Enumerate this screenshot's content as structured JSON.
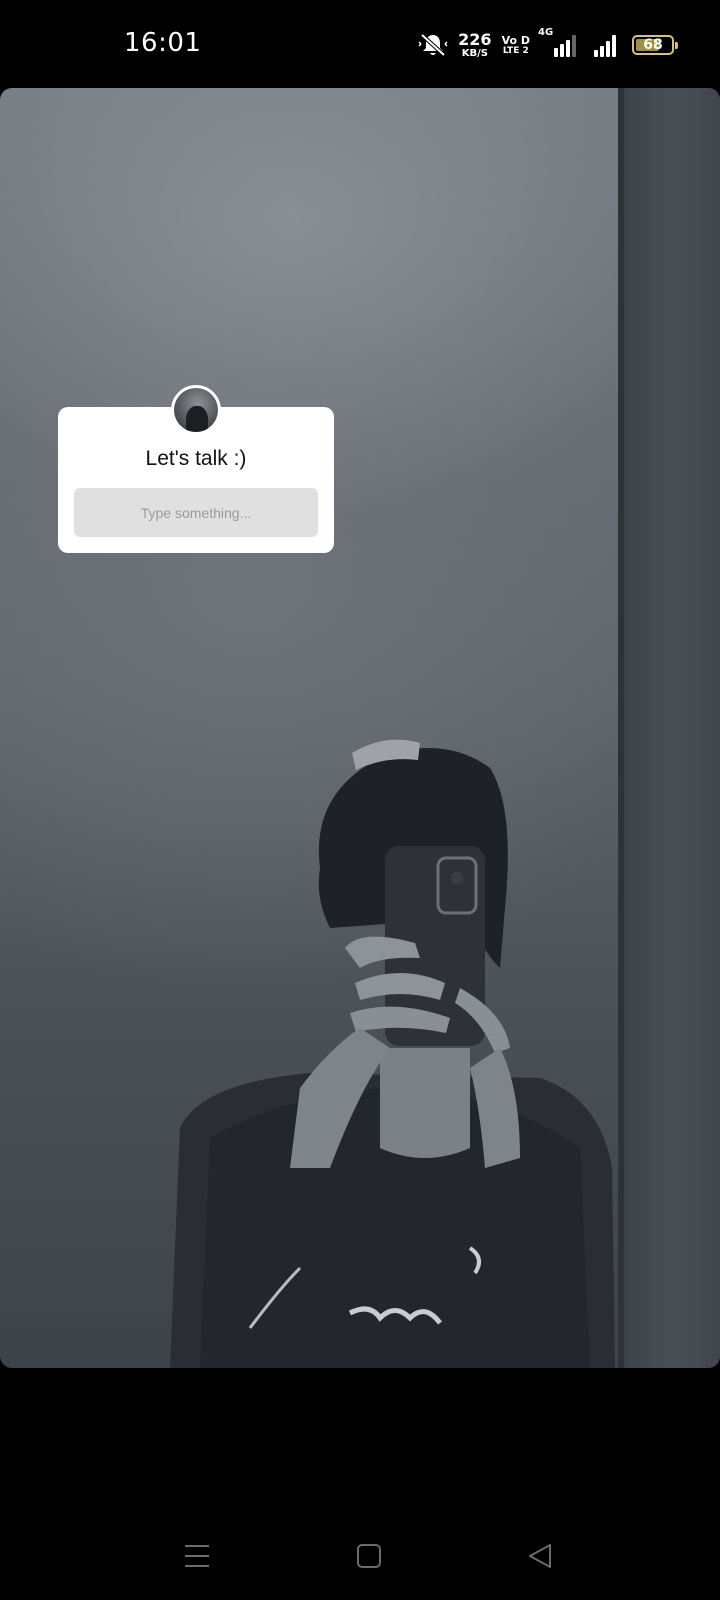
{
  "status_bar": {
    "time": "16:01",
    "net_speed_value": "226",
    "net_speed_unit": "KB/S",
    "volte_top": "Vo D",
    "volte_bottom": "LTE 2",
    "network_type": "4G",
    "battery_level": "68",
    "battery_fraction": 0.68,
    "battery_color": "#d7c27a",
    "icons": [
      "mute-icon",
      "signal-sim1-icon",
      "signal-sim2-icon",
      "battery-icon"
    ]
  },
  "story": {
    "sticker": {
      "title": "Let's talk :)",
      "input_placeholder": "Type something..."
    }
  },
  "nav_bar": {
    "icons": [
      "menu-icon",
      "home-icon",
      "back-icon"
    ]
  }
}
